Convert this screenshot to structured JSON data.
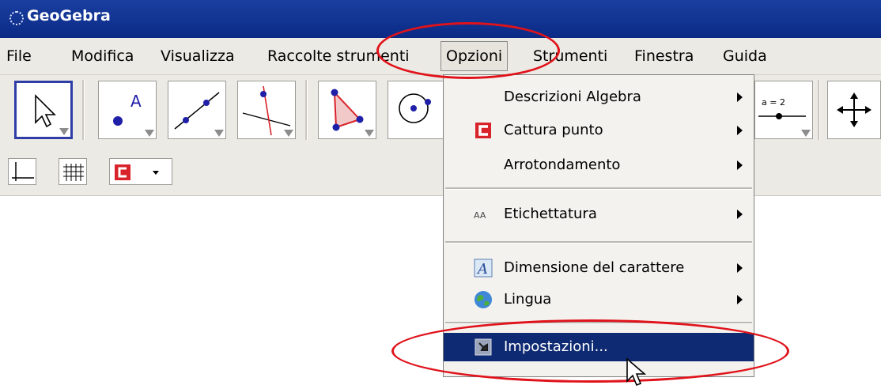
{
  "window": {
    "title": "GeoGebra"
  },
  "menubar": {
    "items": [
      {
        "label": "File"
      },
      {
        "label": "Modifica"
      },
      {
        "label": "Visualizza"
      },
      {
        "label": "Raccolte strumenti"
      },
      {
        "label": "Opzioni",
        "open": true
      },
      {
        "label": "Strumenti"
      },
      {
        "label": "Finestra"
      },
      {
        "label": "Guida"
      }
    ]
  },
  "toolbar": {
    "tools": [
      {
        "icon": "move-arrow-icon",
        "selected": true
      },
      {
        "icon": "new-point-icon",
        "point_label": "A"
      },
      {
        "icon": "line-through-two-points-icon"
      },
      {
        "icon": "perpendicular-line-icon"
      },
      {
        "icon": "polygon-icon"
      },
      {
        "icon": "circle-with-center-icon"
      },
      {
        "icon": "slider-icon",
        "slider_label": "a = 2"
      },
      {
        "icon": "move-graphics-view-icon"
      }
    ],
    "style_bar": [
      {
        "icon": "axes-icon"
      },
      {
        "icon": "grid-icon"
      },
      {
        "icon": "point-capturing-icon"
      }
    ]
  },
  "options_menu": {
    "items": [
      {
        "label": "Descrizioni Algebra",
        "icon": null,
        "submenu": true
      },
      {
        "label": "Cattura punto",
        "icon": "point-capturing-icon",
        "submenu": true
      },
      {
        "label": "Arrotondamento",
        "icon": null,
        "submenu": true
      },
      {
        "label": "Etichettatura",
        "icon": "labeling-icon",
        "icon_text": "AA",
        "submenu": true
      },
      {
        "label": "Dimensione del carattere",
        "icon": "font-size-icon",
        "icon_text": "A",
        "submenu": true
      },
      {
        "label": "Lingua",
        "icon": "globe-icon",
        "submenu": true
      },
      {
        "label": "Impostazioni...",
        "icon": "settings-icon",
        "submenu": false,
        "highlighted": true
      }
    ]
  },
  "colors": {
    "titlebar": "#0b2a86",
    "menu_highlight": "#0e2a72",
    "annotation": "#e0131b",
    "point_blue": "#1f1fa8",
    "geogebra_red": "#d8232a"
  }
}
